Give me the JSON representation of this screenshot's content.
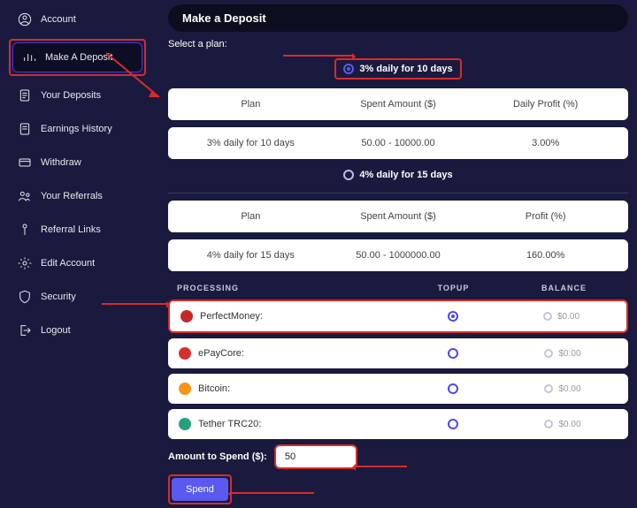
{
  "sidebar": {
    "items": [
      {
        "label": "Account"
      },
      {
        "label": "Make A Deposit"
      },
      {
        "label": "Your Deposits"
      },
      {
        "label": "Earnings History"
      },
      {
        "label": "Withdraw"
      },
      {
        "label": "Your Referrals"
      },
      {
        "label": "Referral Links"
      },
      {
        "label": "Edit Account"
      },
      {
        "label": "Security"
      },
      {
        "label": "Logout"
      }
    ]
  },
  "page": {
    "title": "Make a Deposit",
    "select_plan": "Select a plan:"
  },
  "plans": [
    {
      "radio_label": "3% daily for 10 days",
      "headers": {
        "plan": "Plan",
        "spent": "Spent Amount ($)",
        "profit": "Daily Profit (%)"
      },
      "row": {
        "plan": "3% daily for 10 days",
        "spent": "50.00 - 10000.00",
        "profit": "3.00%"
      },
      "selected": true
    },
    {
      "radio_label": "4% daily for 15 days",
      "headers": {
        "plan": "Plan",
        "spent": "Spent Amount ($)",
        "profit": "Profit (%)"
      },
      "row": {
        "plan": "4% daily for 15 days",
        "spent": "50.00 - 1000000.00",
        "profit": "160.00%"
      },
      "selected": false
    }
  ],
  "processing": {
    "headers": {
      "proc": "PROCESSING",
      "topup": "TOPUP",
      "balance": "BALANCE"
    },
    "rows": [
      {
        "name": "PerfectMoney:",
        "balance": "$0.00",
        "topup_selected": true
      },
      {
        "name": "ePayCore:",
        "balance": "$0.00",
        "topup_selected": false
      },
      {
        "name": "Bitcoin:",
        "balance": "$0.00",
        "topup_selected": false
      },
      {
        "name": "Tether TRC20:",
        "balance": "$0.00",
        "topup_selected": false
      }
    ]
  },
  "amount": {
    "label": "Amount to Spend ($):",
    "value": "50"
  },
  "buttons": {
    "spend": "Spend"
  }
}
